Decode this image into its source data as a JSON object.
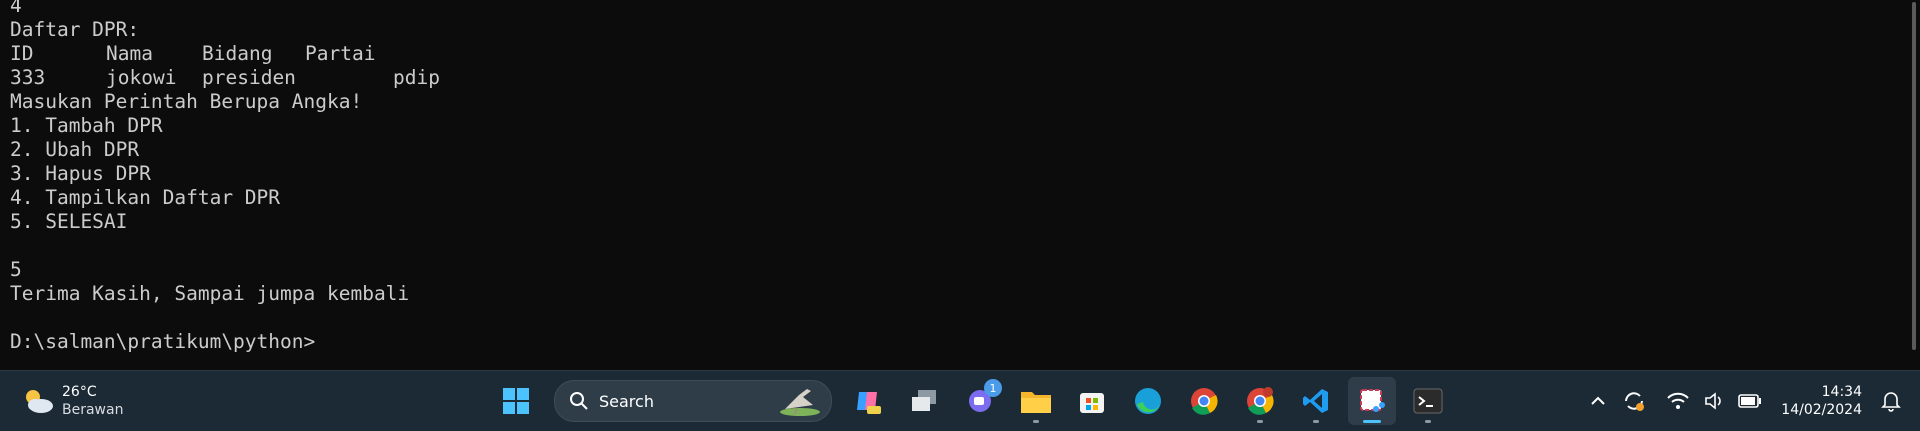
{
  "terminal": {
    "lines": [
      {
        "cells": [
          "4"
        ]
      },
      {
        "cells": [
          "Daftar DPR:"
        ]
      },
      {
        "cells": [
          "ID",
          "Nama",
          "Bidang",
          "Partai"
        ]
      },
      {
        "cells": [
          "333",
          "jokowi",
          "presiden",
          "pdip"
        ]
      },
      {
        "cells": [
          "Masukan Perintah Berupa Angka!"
        ]
      },
      {
        "cells": [
          "1. Tambah DPR"
        ]
      },
      {
        "cells": [
          "2. Ubah DPR"
        ]
      },
      {
        "cells": [
          "3. Hapus DPR"
        ]
      },
      {
        "cells": [
          "4. Tampilkan Daftar DPR"
        ]
      },
      {
        "cells": [
          "5. SELESAI"
        ]
      },
      {
        "cells": [
          ""
        ]
      },
      {
        "cells": [
          "5"
        ]
      },
      {
        "cells": [
          "Terima Kasih, Sampai jumpa kembali"
        ]
      },
      {
        "cells": [
          ""
        ]
      },
      {
        "cells": [
          "D:\\salman\\pratikum\\python>"
        ]
      }
    ]
  },
  "taskbar": {
    "weather": {
      "temperature": "26°C",
      "condition": "Berawan",
      "icon": "partly-cloudy-icon"
    },
    "search": {
      "label": "Search",
      "icon": "search-icon"
    },
    "apps": [
      {
        "name": "windows-start",
        "icon": "windows-logo-icon"
      },
      {
        "name": "copilot",
        "icon": "copilot-icon"
      },
      {
        "name": "task-view",
        "icon": "task-view-icon"
      },
      {
        "name": "chat",
        "icon": "chat-icon",
        "badge": "1"
      },
      {
        "name": "file-explorer",
        "icon": "folder-icon"
      },
      {
        "name": "microsoft-store",
        "icon": "store-icon"
      },
      {
        "name": "edge",
        "icon": "edge-icon"
      },
      {
        "name": "chrome",
        "icon": "chrome-icon"
      },
      {
        "name": "chrome-profile",
        "icon": "chrome-icon"
      },
      {
        "name": "vscode",
        "icon": "vscode-icon"
      },
      {
        "name": "snipping-tool",
        "icon": "snipping-tool-icon"
      },
      {
        "name": "terminal",
        "icon": "terminal-icon"
      }
    ],
    "clock": {
      "time": "14:34",
      "date": "14/02/2024"
    },
    "colors": {
      "taskbar": "#1c2a35",
      "terminal_bg": "#0c0c0c",
      "terminal_text": "#cccccc",
      "accent": "#4cc2ff"
    }
  }
}
